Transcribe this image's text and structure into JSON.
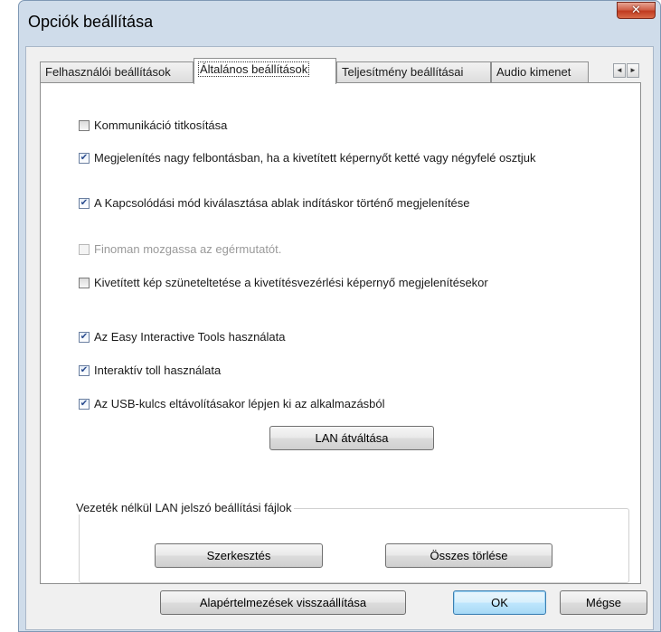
{
  "window": {
    "title": "Opciók beállítása",
    "close_glyph": "✕"
  },
  "tabs": [
    {
      "label": "Felhasználói beállítások",
      "active": false
    },
    {
      "label": "Általános beállítások",
      "active": true
    },
    {
      "label": "Teljesítmény beállításai",
      "active": false
    },
    {
      "label": "Audio kimenet",
      "active": false
    }
  ],
  "tab_scroll": {
    "left_glyph": "◄",
    "right_glyph": "►"
  },
  "options": [
    {
      "label": "Kommunikáció titkosítása",
      "checked": false,
      "enabled": true
    },
    {
      "label": "Megjelenítés nagy felbontásban, ha a kivetített képernyőt ketté vagy négyfelé osztjuk",
      "checked": true,
      "enabled": true
    },
    {
      "label": "A Kapcsolódási mód kiválasztása ablak indításkor történő megjelenítése",
      "checked": true,
      "enabled": true
    },
    {
      "label": "Finoman mozgassa az egérmutatót.",
      "checked": false,
      "enabled": false
    },
    {
      "label": "Kivetített kép szüneteltetése a kivetítésvezérlési képernyő megjelenítésekor",
      "checked": false,
      "enabled": true
    },
    {
      "label": "Az Easy Interactive Tools használata",
      "checked": true,
      "enabled": true
    },
    {
      "label": "Interaktív toll használata",
      "checked": true,
      "enabled": true
    },
    {
      "label": "Az USB-kulcs eltávolításakor lépjen ki az alkalmazásból",
      "checked": true,
      "enabled": true
    }
  ],
  "lan_switch_label": "LAN átváltása",
  "wireless_group": {
    "label": "Vezeték nélkül LAN jelszó beállítási fájlok",
    "edit_label": "Szerkesztés",
    "delete_all_label": "Összes törlése"
  },
  "footer": {
    "restore_defaults_label": "Alapértelmezések visszaállítása",
    "ok_label": "OK",
    "cancel_label": "Mégse"
  }
}
